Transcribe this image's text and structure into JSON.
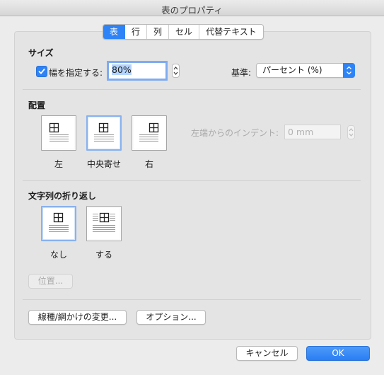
{
  "window": {
    "title": "表のプロパティ"
  },
  "tabs": [
    {
      "label": "表",
      "active": true
    },
    {
      "label": "行",
      "active": false
    },
    {
      "label": "列",
      "active": false
    },
    {
      "label": "セル",
      "active": false
    },
    {
      "label": "代替テキスト",
      "active": false
    }
  ],
  "size": {
    "title": "サイズ",
    "width_checkbox_label": "幅を指定する:",
    "width_checked": true,
    "width_value": "80%",
    "basis_label": "基準:",
    "basis_value": "パーセント (%)"
  },
  "alignment": {
    "title": "配置",
    "options": [
      {
        "label": "左",
        "selected": false
      },
      {
        "label": "中央寄せ",
        "selected": true
      },
      {
        "label": "右",
        "selected": false
      }
    ],
    "indent_label": "左端からのインデント:",
    "indent_value": "0 mm"
  },
  "wrapping": {
    "title": "文字列の折り返し",
    "options": [
      {
        "label": "なし",
        "selected": true
      },
      {
        "label": "する",
        "selected": false
      }
    ],
    "position_button": "位置..."
  },
  "buttons": {
    "borders": "線種/網かけの変更...",
    "options": "オプション...",
    "cancel": "キャンセル",
    "ok": "OK"
  },
  "colors": {
    "accent": "#2e83f6",
    "focus_ring": "#7eacf1"
  }
}
